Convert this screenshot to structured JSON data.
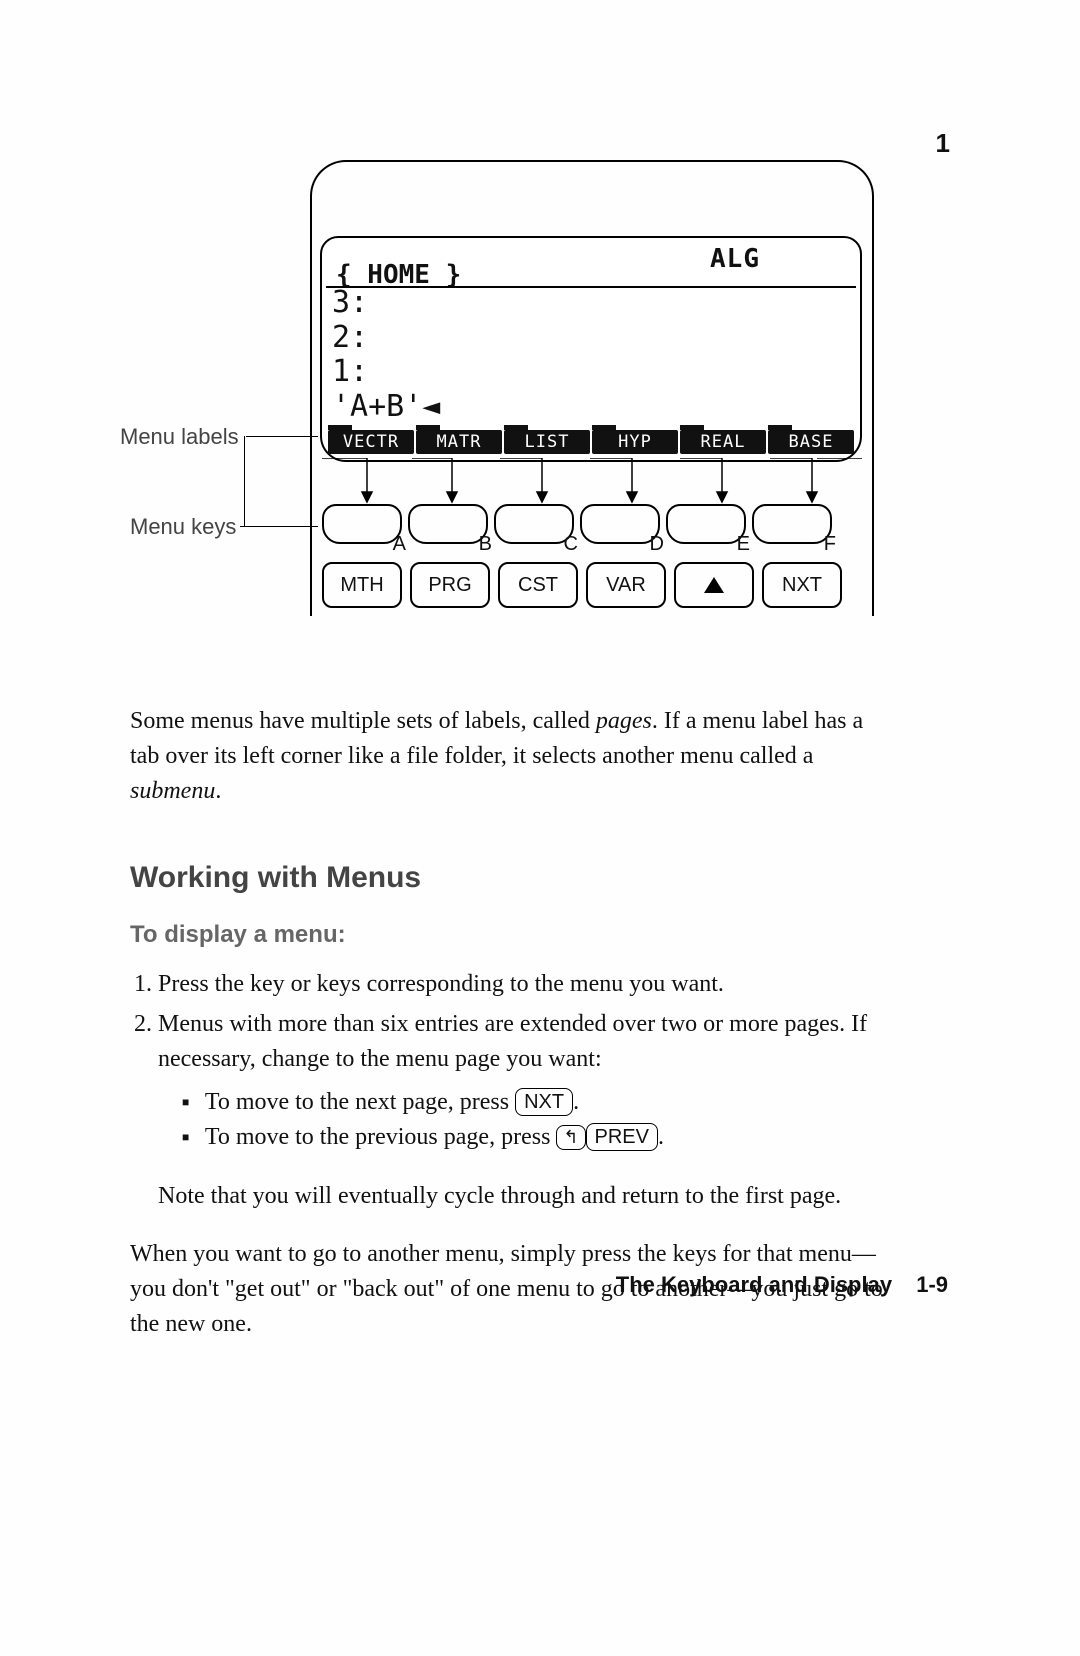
{
  "chapter_number": "1",
  "figure": {
    "callout_labels": "Menu labels",
    "callout_keys": "Menu keys",
    "lcd": {
      "status": "ALG",
      "home": "{ HOME }",
      "stack": [
        "3:",
        "2:",
        "1:",
        "'A+B'◄"
      ],
      "menu": [
        "VECTR",
        "MATR",
        "LIST",
        "HYP",
        "REAL",
        "BASE"
      ]
    },
    "softkey_letters": [
      "A",
      "B",
      "C",
      "D",
      "E",
      "F"
    ],
    "hardkeys": [
      "MTH",
      "PRG",
      "CST",
      "VAR",
      "▲",
      "NXT"
    ]
  },
  "para1_a": "Some menus have multiple sets of labels, called ",
  "para1_pages": "pages",
  "para1_b": ". If a menu label has a tab over its left corner like a file folder, it selects another menu called a ",
  "para1_submenu": "submenu",
  "para1_c": ".",
  "h2": "Working with Menus",
  "h3": "To display a menu:",
  "step1": "Press the key or keys corresponding to the menu you want.",
  "step2": "Menus with more than six entries are extended over two or more pages. If necessary, change to the menu page you want:",
  "bullet1_a": "To move to the next page, press ",
  "key_nxt": "NXT",
  "bullet1_b": ".",
  "bullet2_a": "To move to the previous page, press ",
  "shift_glyph": "↰",
  "key_prev": "PREV",
  "bullet2_b": ".",
  "note": "Note that you will eventually cycle through and return to the first page.",
  "para2": "When you want to go to another menu, simply press the keys for that menu—you don't \"get out\" or \"back out\" of one menu to go to another—you just go to the new one.",
  "footer_title": "The Keyboard and Display",
  "footer_page": "1-9"
}
